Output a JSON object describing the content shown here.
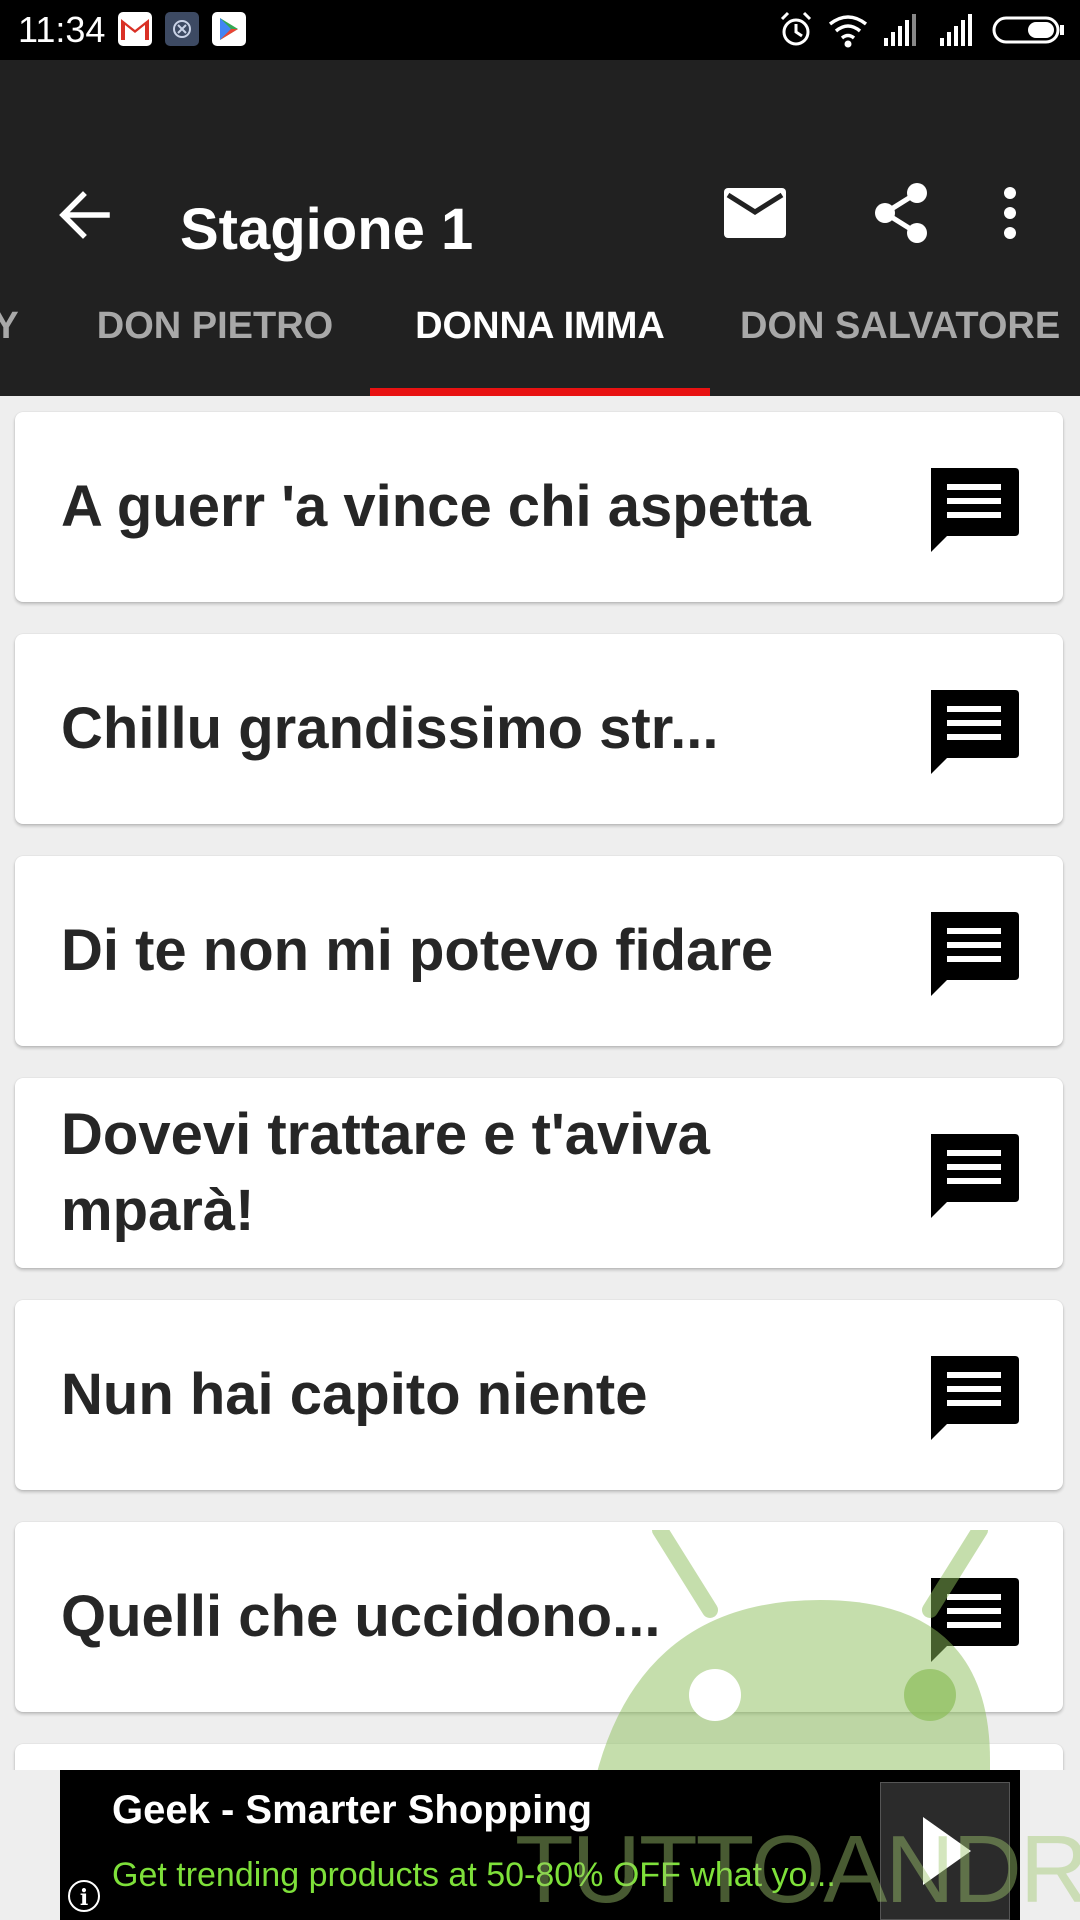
{
  "status_bar": {
    "time": "11:34",
    "notification_icons": [
      "gmail-icon",
      "photo-gallery-icon",
      "play-store-icon"
    ],
    "right_icons": [
      "alarm-icon",
      "wifi-icon",
      "signal-icon",
      "signal-icon",
      "battery-icon"
    ]
  },
  "app_bar": {
    "title": "Stagione 1",
    "actions": [
      "back-arrow-icon",
      "mail-icon",
      "share-icon",
      "more-vert-icon"
    ]
  },
  "tabs": [
    {
      "label": "Y",
      "active": false
    },
    {
      "label": "DON PIETRO",
      "active": false
    },
    {
      "label": "DONNA IMMA",
      "active": true
    },
    {
      "label": "DON SALVATORE",
      "active": false
    }
  ],
  "list": {
    "items": [
      {
        "text": "A guerr 'a vince chi aspetta",
        "icon": "message-icon"
      },
      {
        "text": "Chillu grandissimo str...",
        "icon": "message-icon"
      },
      {
        "text": "Di te non mi potevo fidare",
        "icon": "message-icon"
      },
      {
        "text": "Dovevi trattare e t'aviva mparà!",
        "icon": "message-icon"
      },
      {
        "text": "Nun hai capito niente",
        "icon": "message-icon"
      },
      {
        "text": "Quelli che uccidono...",
        "icon": "message-icon"
      }
    ]
  },
  "ad": {
    "title": "Geek - Smarter Shopping",
    "description": "Get trending products at 50-80% OFF what yo...",
    "info_glyph": "i",
    "accent_color": "#7ee03a"
  },
  "watermark": {
    "text": "TUTTOANDROID"
  },
  "colors": {
    "app_bar": "#212121",
    "tab_indicator": "#e81212",
    "background": "#eeeeee"
  }
}
